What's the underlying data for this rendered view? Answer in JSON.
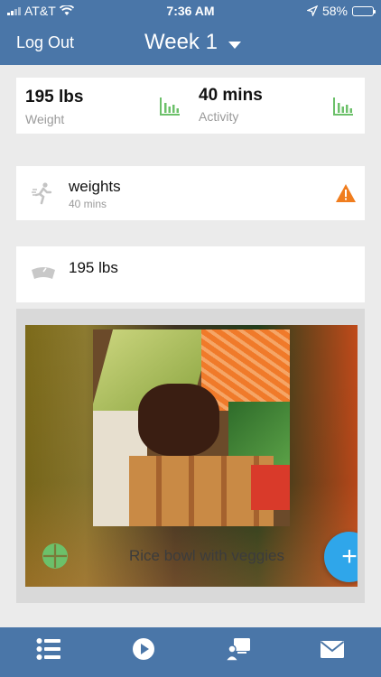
{
  "status_bar": {
    "carrier": "AT&T",
    "time": "7:36 AM",
    "battery": "58%",
    "battery_level": 0.58
  },
  "header": {
    "logout_label": "Log Out",
    "week_title": "Week 1"
  },
  "stats": {
    "weight_value": "195 lbs",
    "weight_label": "Weight",
    "activity_value": "40 mins",
    "activity_label": "Activity"
  },
  "activity_item": {
    "title": "weights",
    "subtitle": "40 mins",
    "icon": "running-person-icon",
    "alert_icon": "warning-icon"
  },
  "weight_item": {
    "title": "195 lbs",
    "icon": "scale-icon"
  },
  "meal": {
    "label": "Rice bowl with veggies",
    "icon": "plate-icon",
    "add_label": "+"
  },
  "tabs": [
    "list-icon",
    "play-icon",
    "coach-icon",
    "mail-icon"
  ],
  "colors": {
    "header": "#4a76a8",
    "accent_green": "#6cc06a",
    "alert_orange": "#f07d1e",
    "fab_blue": "#2fa6ea"
  }
}
